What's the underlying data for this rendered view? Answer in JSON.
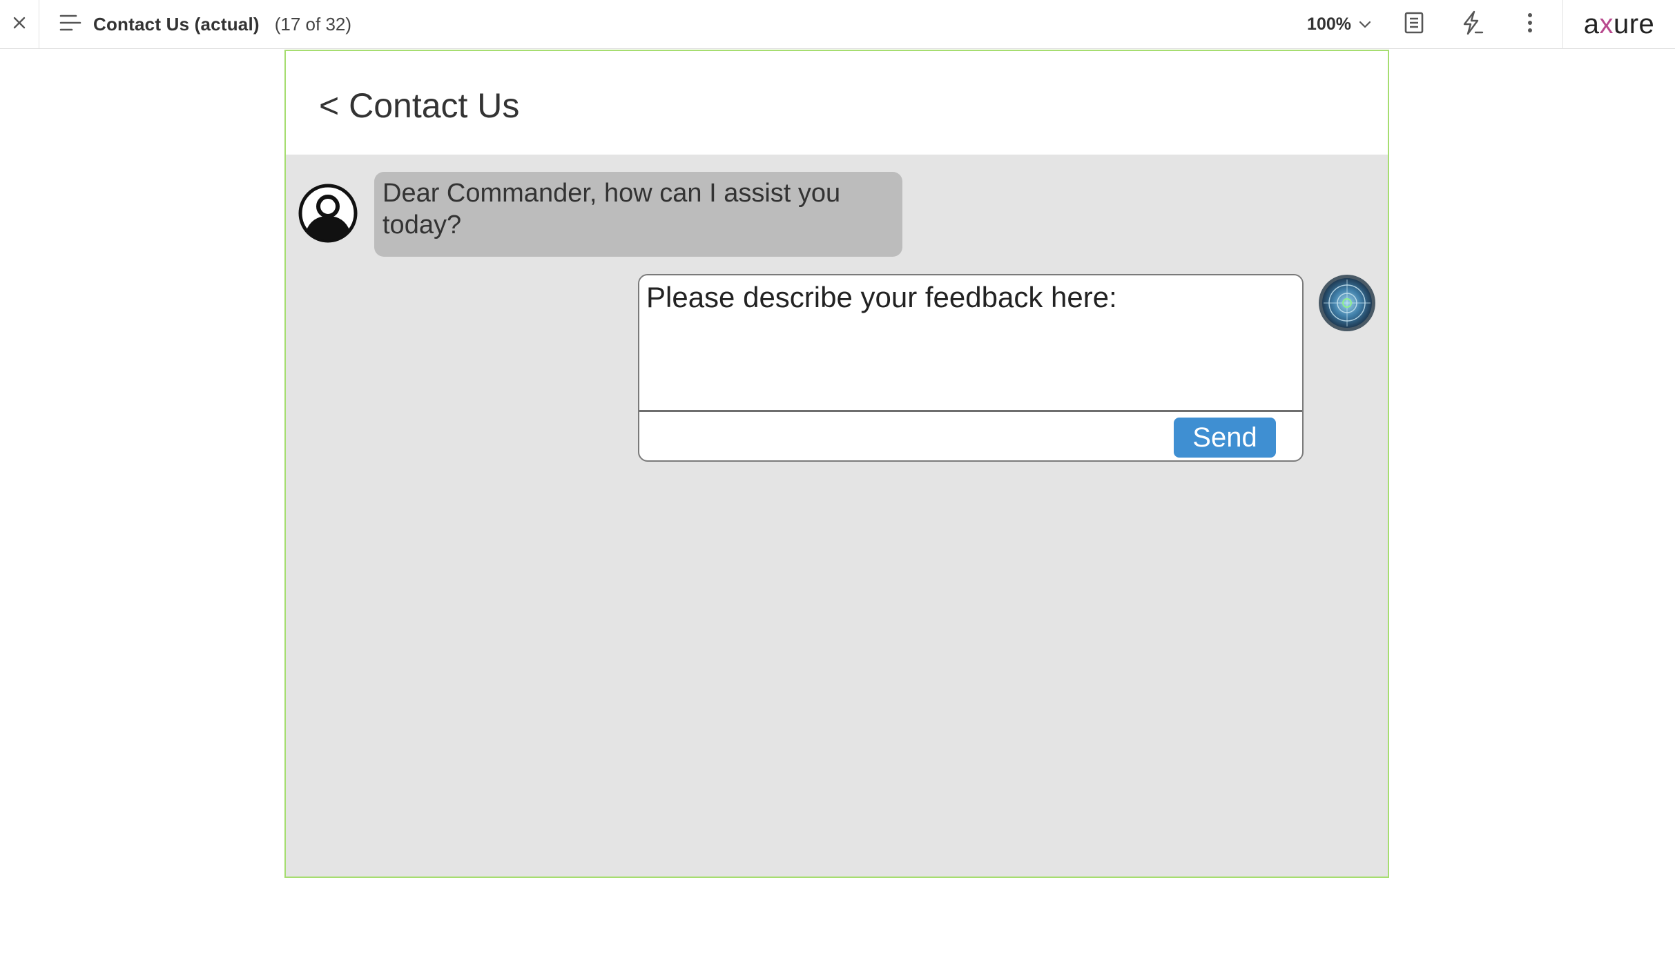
{
  "toolbar": {
    "page_title": "Contact Us (actual)",
    "page_count": "(17 of 32)",
    "zoom": "100%",
    "brand_pre": "a",
    "brand_x": "x",
    "brand_post": "ure"
  },
  "prototype": {
    "header_title": "< Contact Us",
    "bot_message": "Dear Commander, how can I assist you today?",
    "feedback_placeholder": "Please describe your feedback here:",
    "send_label": "Send"
  },
  "colors": {
    "frame_border": "#a6dd70",
    "content_bg": "#e4e4e4",
    "bubble_bg": "#bcbcbc",
    "send_button": "#3f8fd2",
    "brand_accent": "#b84a8e"
  },
  "icons": {
    "close": "close-icon",
    "menu": "hamburger-menu-icon",
    "zoom_caret": "chevron-down-icon",
    "notes": "document-notes-icon",
    "interactions": "lightning-icon",
    "more": "more-vertical-icon",
    "bot_avatar": "user-avatar-icon",
    "user_avatar": "radar-avatar-icon"
  }
}
